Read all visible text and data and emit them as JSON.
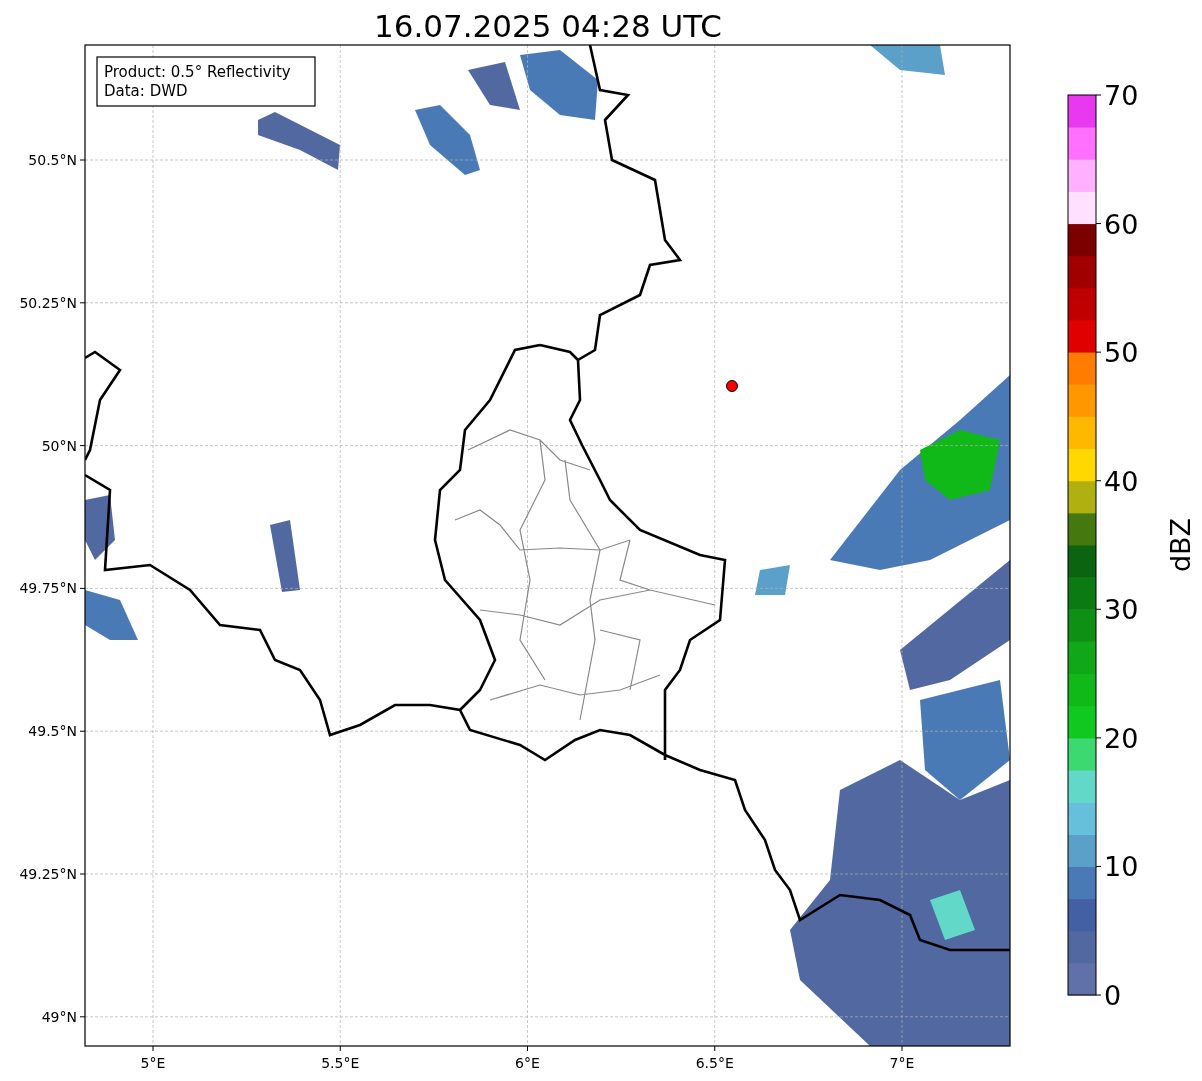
{
  "title": "16.07.2025 04:28 UTC",
  "legend": {
    "lines": [
      "Product: 0.5° Reflectivity",
      "Data: DWD"
    ]
  },
  "map": {
    "x_ticks": [
      "5°E",
      "5.5°E",
      "6°E",
      "6.5°E",
      "7°E"
    ],
    "y_ticks": [
      "50.5°N",
      "50.25°N",
      "50°N",
      "49.75°N",
      "49.5°N",
      "49.25°N",
      "49°N"
    ]
  },
  "colorbar": {
    "label": "dBZ",
    "ticks": [
      "70",
      "60",
      "50",
      "40",
      "30",
      "20",
      "10",
      "0"
    ],
    "segments": [
      {
        "color": "#6070a8"
      },
      {
        "color": "#5268a0"
      },
      {
        "color": "#4460a4"
      },
      {
        "color": "#4a7ab5"
      },
      {
        "color": "#5aa0c8"
      },
      {
        "color": "#66c0dc"
      },
      {
        "color": "#62d8c8"
      },
      {
        "color": "#3cd870"
      },
      {
        "color": "#10c820"
      },
      {
        "color": "#10b818"
      },
      {
        "color": "#10a818"
      },
      {
        "color": "#0e9014"
      },
      {
        "color": "#0c7a12"
      },
      {
        "color": "#0a6410"
      },
      {
        "color": "#467810"
      },
      {
        "color": "#b0b010"
      },
      {
        "color": "#ffd800"
      },
      {
        "color": "#ffb800"
      },
      {
        "color": "#ff9800"
      },
      {
        "color": "#ff7c00"
      },
      {
        "color": "#e00000"
      },
      {
        "color": "#c00000"
      },
      {
        "color": "#a00000"
      },
      {
        "color": "#7c0000"
      },
      {
        "color": "#ffe0ff"
      },
      {
        "color": "#ffb0ff"
      },
      {
        "color": "#ff70ff"
      },
      {
        "color": "#e838f0"
      }
    ]
  }
}
